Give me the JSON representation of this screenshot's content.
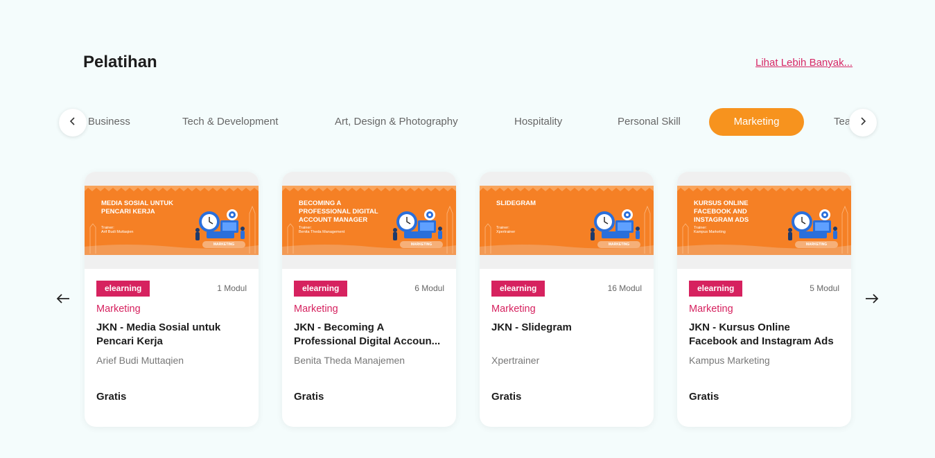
{
  "section": {
    "title": "Pelatihan",
    "see_more": "Lihat Lebih Banyak..."
  },
  "tabs": [
    {
      "label": "Business",
      "active": false
    },
    {
      "label": "Tech & Development",
      "active": false
    },
    {
      "label": "Art, Design & Photography",
      "active": false
    },
    {
      "label": "Hospitality",
      "active": false
    },
    {
      "label": "Personal Skill",
      "active": false
    },
    {
      "label": "Marketing",
      "active": true
    },
    {
      "label": "Teaching & Academics",
      "active": false
    }
  ],
  "colors": {
    "accent_orange": "#f7931e",
    "brand_pink": "#d6225f",
    "banner_orange": "#f58025",
    "background": "#f4fcfc"
  },
  "icons": {
    "tabs_prev": "chevron-left-icon",
    "tabs_next": "chevron-right-icon",
    "carousel_prev": "arrow-left-icon",
    "carousel_next": "arrow-right-icon"
  },
  "cards": [
    {
      "banner_title": "MEDIA SOSIAL UNTUK PENCARI KERJA",
      "banner_trainer_label": "Trainer:",
      "banner_trainer": "Arif Budi Muttaqien",
      "banner_tag": "MARKETING",
      "badge": "elearning",
      "modules": "1 Modul",
      "category": "Marketing",
      "title": "JKN - Media Sosial untuk Pencari Kerja",
      "provider": "Arief Budi Muttaqien",
      "price": "Gratis"
    },
    {
      "banner_title": "BECOMING A PROFESSIONAL DIGITAL ACCOUNT MANAGER",
      "banner_trainer_label": "Trainer:",
      "banner_trainer": "Benita Theda Management",
      "banner_tag": "MARKETING",
      "badge": "elearning",
      "modules": "6 Modul",
      "category": "Marketing",
      "title": "JKN - Becoming A Professional Digital Accoun...",
      "provider": "Benita Theda Manajemen",
      "price": "Gratis"
    },
    {
      "banner_title": "SLIDEGRAM",
      "banner_trainer_label": "Trainer:",
      "banner_trainer": "Xpertrainer",
      "banner_tag": "MARKETING",
      "badge": "elearning",
      "modules": "16 Modul",
      "category": "Marketing",
      "title": "JKN - Slidegram",
      "provider": "Xpertrainer",
      "price": "Gratis"
    },
    {
      "banner_title": "KURSUS ONLINE FACEBOOK AND INSTAGRAM ADS",
      "banner_trainer_label": "Trainer:",
      "banner_trainer": "Kampus Marketing",
      "banner_tag": "MARKETING",
      "badge": "elearning",
      "modules": "5 Modul",
      "category": "Marketing",
      "title": "JKN - Kursus Online Facebook and Instagram Ads",
      "provider": "Kampus Marketing",
      "price": "Gratis"
    }
  ]
}
